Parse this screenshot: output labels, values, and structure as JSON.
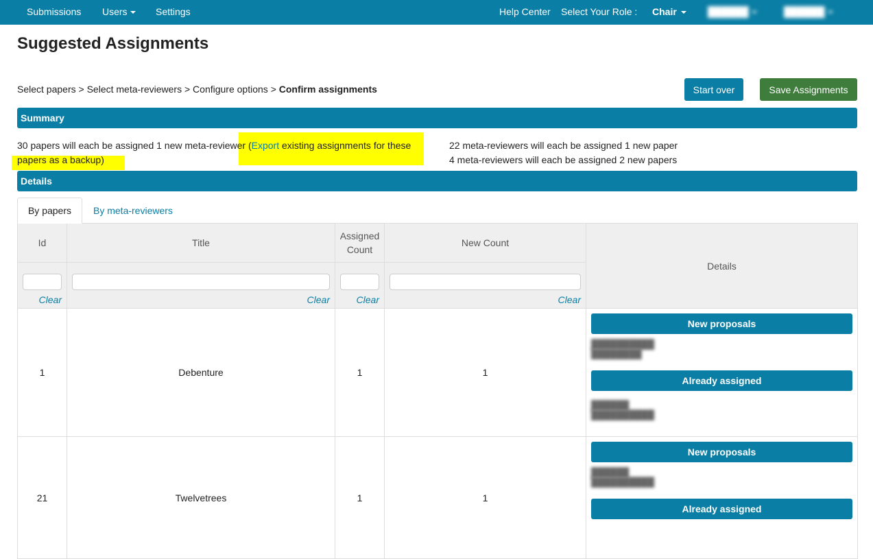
{
  "nav": {
    "submissions": "Submissions",
    "users": "Users",
    "settings": "Settings",
    "help_center": "Help Center",
    "select_role_label": "Select Your Role :",
    "role": "Chair"
  },
  "page": {
    "title": "Suggested Assignments"
  },
  "breadcrumb": {
    "step1": "Select papers",
    "step2": "Select meta-reviewers",
    "step3": "Configure options",
    "current": "Confirm assignments",
    "separator": ">"
  },
  "buttons": {
    "start_over": "Start over",
    "save_assignments": "Save Assignments"
  },
  "summary": {
    "heading": "Summary",
    "papers_text": "30 papers will each be assigned 1 new meta-reviewer (",
    "export_link": "Export",
    "papers_text_after": " existing assignments for these papers as a backup)",
    "meta_line1": "22 meta-reviewers will each be assigned 1 new paper",
    "meta_line2": "4 meta-reviewers will each be assigned 2 new papers"
  },
  "details": {
    "heading": "Details",
    "tabs": [
      "By papers",
      "By meta-reviewers"
    ]
  },
  "table": {
    "columns": {
      "id": "Id",
      "title": "Title",
      "assigned_count": "Assigned Count",
      "new_count": "New Count",
      "details": "Details"
    },
    "clear_label": "Clear",
    "new_proposals_label": "New proposals",
    "already_assigned_label": "Already assigned",
    "rows": [
      {
        "id": "1",
        "title": "Debenture",
        "assigned": "1",
        "new": "1"
      },
      {
        "id": "21",
        "title": "Twelvetrees",
        "assigned": "1",
        "new": "1"
      }
    ]
  }
}
